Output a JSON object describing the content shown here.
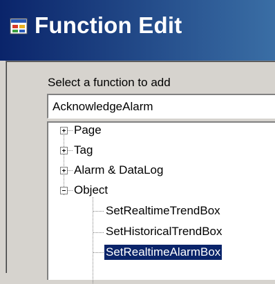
{
  "window": {
    "title": "Function Edit",
    "title_icon": "app-window-icon",
    "accent_colors": {
      "titlebar_start": "#0a246a",
      "titlebar_end": "#3a6ea5",
      "selection": "#0a246a"
    }
  },
  "form": {
    "prompt_label": "Select a function to add",
    "selected_function": "AcknowledgeAlarm"
  },
  "tree": {
    "nodes": [
      {
        "label": "Page",
        "expander": "plus"
      },
      {
        "label": "Tag",
        "expander": "plus"
      },
      {
        "label": "Alarm & DataLog",
        "expander": "plus"
      },
      {
        "label": "Object",
        "expander": "minus",
        "children": [
          {
            "label": "SetRealtimeTrendBox"
          },
          {
            "label": "SetHistoricalTrendBox"
          },
          {
            "label": "SetRealtimeAlarmBox",
            "selected": true
          }
        ]
      }
    ]
  }
}
